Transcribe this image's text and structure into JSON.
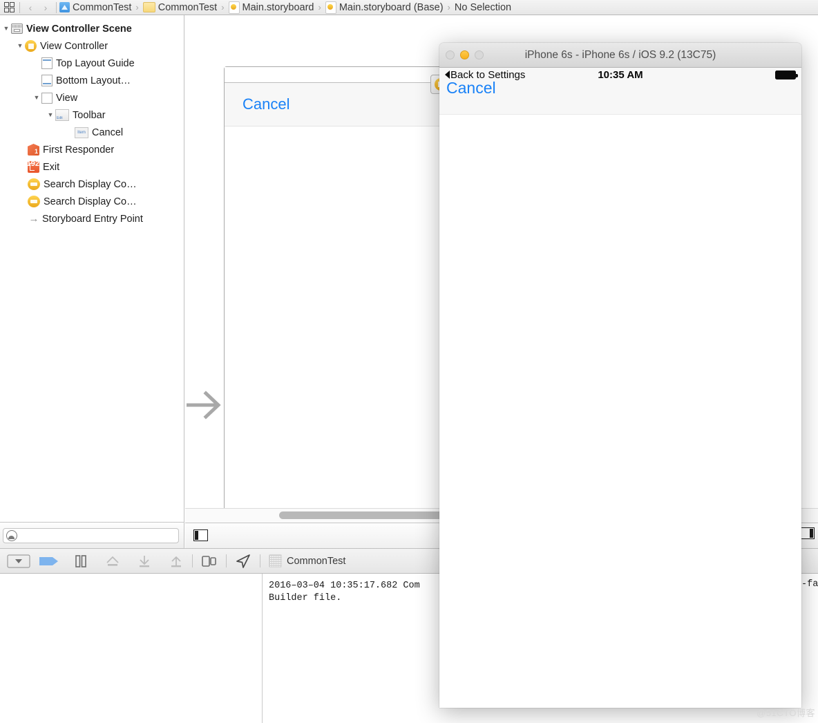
{
  "jumpbar": {
    "grid_icon": "grid-icon",
    "back_arrow": "‹",
    "forward_arrow": "›",
    "chevron": "›",
    "items": [
      {
        "label": "CommonTest",
        "icon": "project-icon"
      },
      {
        "label": "CommonTest",
        "icon": "folder-icon"
      },
      {
        "label": "Main.storyboard",
        "icon": "storyboard-icon"
      },
      {
        "label": "Main.storyboard (Base)",
        "icon": "storyboard-icon"
      },
      {
        "label": "No Selection",
        "icon": "none"
      }
    ]
  },
  "outline": {
    "disclosure_open": "▼",
    "items": [
      {
        "label": "View Controller Scene",
        "icon": "scene-icon",
        "indent": 0,
        "disclosure": "open",
        "bold": true
      },
      {
        "label": "View Controller",
        "icon": "view-controller-icon",
        "indent": 1,
        "disclosure": "open",
        "bold": false
      },
      {
        "label": "Top Layout Guide",
        "icon": "top-layout-guide-icon",
        "indent": 2,
        "disclosure": "none",
        "bold": false
      },
      {
        "label": "Bottom Layout…",
        "icon": "bottom-layout-guide-icon",
        "indent": 2,
        "disclosure": "none",
        "bold": false
      },
      {
        "label": "View",
        "icon": "view-icon",
        "indent": 2,
        "disclosure": "open",
        "bold": false
      },
      {
        "label": "Toolbar",
        "icon": "toolbar-icon",
        "indent": 3,
        "disclosure": "open",
        "bold": false
      },
      {
        "label": "Cancel",
        "icon": "bar-button-item-icon",
        "indent": 4,
        "disclosure": "none",
        "bold": false
      },
      {
        "label": "First Responder",
        "icon": "first-responder-icon",
        "indent": 1,
        "disclosure": "none",
        "bold": false
      },
      {
        "label": "Exit",
        "icon": "exit-icon",
        "indent": 1,
        "disclosure": "none",
        "bold": false
      },
      {
        "label": "Search Display Co…",
        "icon": "search-display-controller-icon",
        "indent": 1,
        "disclosure": "none",
        "bold": false
      },
      {
        "label": "Search Display Co…",
        "icon": "search-display-controller-icon",
        "indent": 1,
        "disclosure": "none",
        "bold": false
      },
      {
        "label": "Storyboard Entry Point",
        "icon": "entry-point-arrow-icon",
        "indent": 1,
        "disclosure": "none",
        "bold": false
      }
    ],
    "filter": {
      "value": "",
      "placeholder": "",
      "icon": "filter-icon"
    }
  },
  "canvas": {
    "toolbar_item_label": "Cancel",
    "entry_point_icon": "entry-point-arrow-icon",
    "scene_dock": {
      "view_controller_icon": "view-controller-icon",
      "first_responder_icon": "first-responder-icon",
      "exit_icon": "exit-icon"
    },
    "scrollbar": "horizontal-scrollbar"
  },
  "debug_toolbar": {
    "buttons": [
      {
        "name": "hide-debug-area-button",
        "icon": "hide-debug-area-icon",
        "enabled": true
      },
      {
        "name": "continue-button",
        "icon": "continue-flag-icon",
        "enabled": true
      },
      {
        "name": "pause-button",
        "icon": "pause-icon",
        "enabled": true
      },
      {
        "name": "step-over-button",
        "icon": "step-over-icon",
        "enabled": false
      },
      {
        "name": "step-into-button",
        "icon": "step-into-icon",
        "enabled": false
      },
      {
        "name": "step-out-button",
        "icon": "step-out-icon",
        "enabled": false
      },
      {
        "name": "debug-view-hierarchy-button",
        "icon": "view-hierarchy-icon",
        "enabled": true
      },
      {
        "name": "simulate-location-button",
        "icon": "location-arrow-icon",
        "enabled": true
      }
    ],
    "process_label": "CommonTest",
    "process_icon": "process-icon"
  },
  "console": {
    "lines": [
      "2016‒03‒04 10:35:17.682 Com",
      "Builder file."
    ],
    "hidden_right_fragment": "‑fac"
  },
  "simulator": {
    "title": "iPhone 6s - iPhone 6s / iOS 9.2 (13C75)",
    "traffic_lights": {
      "close": "close-button",
      "minimize": "minimize-button",
      "zoom": "zoom-button"
    },
    "status_bar": {
      "back_label": "Back to Settings",
      "time": "10:35 AM",
      "battery": "battery-icon"
    },
    "toolbar": {
      "cancel_label": "Cancel"
    }
  },
  "watermark": {
    "text": "@51CTO博客"
  },
  "colors": {
    "ios_blue": "#1a82f7",
    "accent_yellow": "#eaa81b",
    "accent_orange": "#e8552a",
    "chrome": "#e6e6e6"
  }
}
